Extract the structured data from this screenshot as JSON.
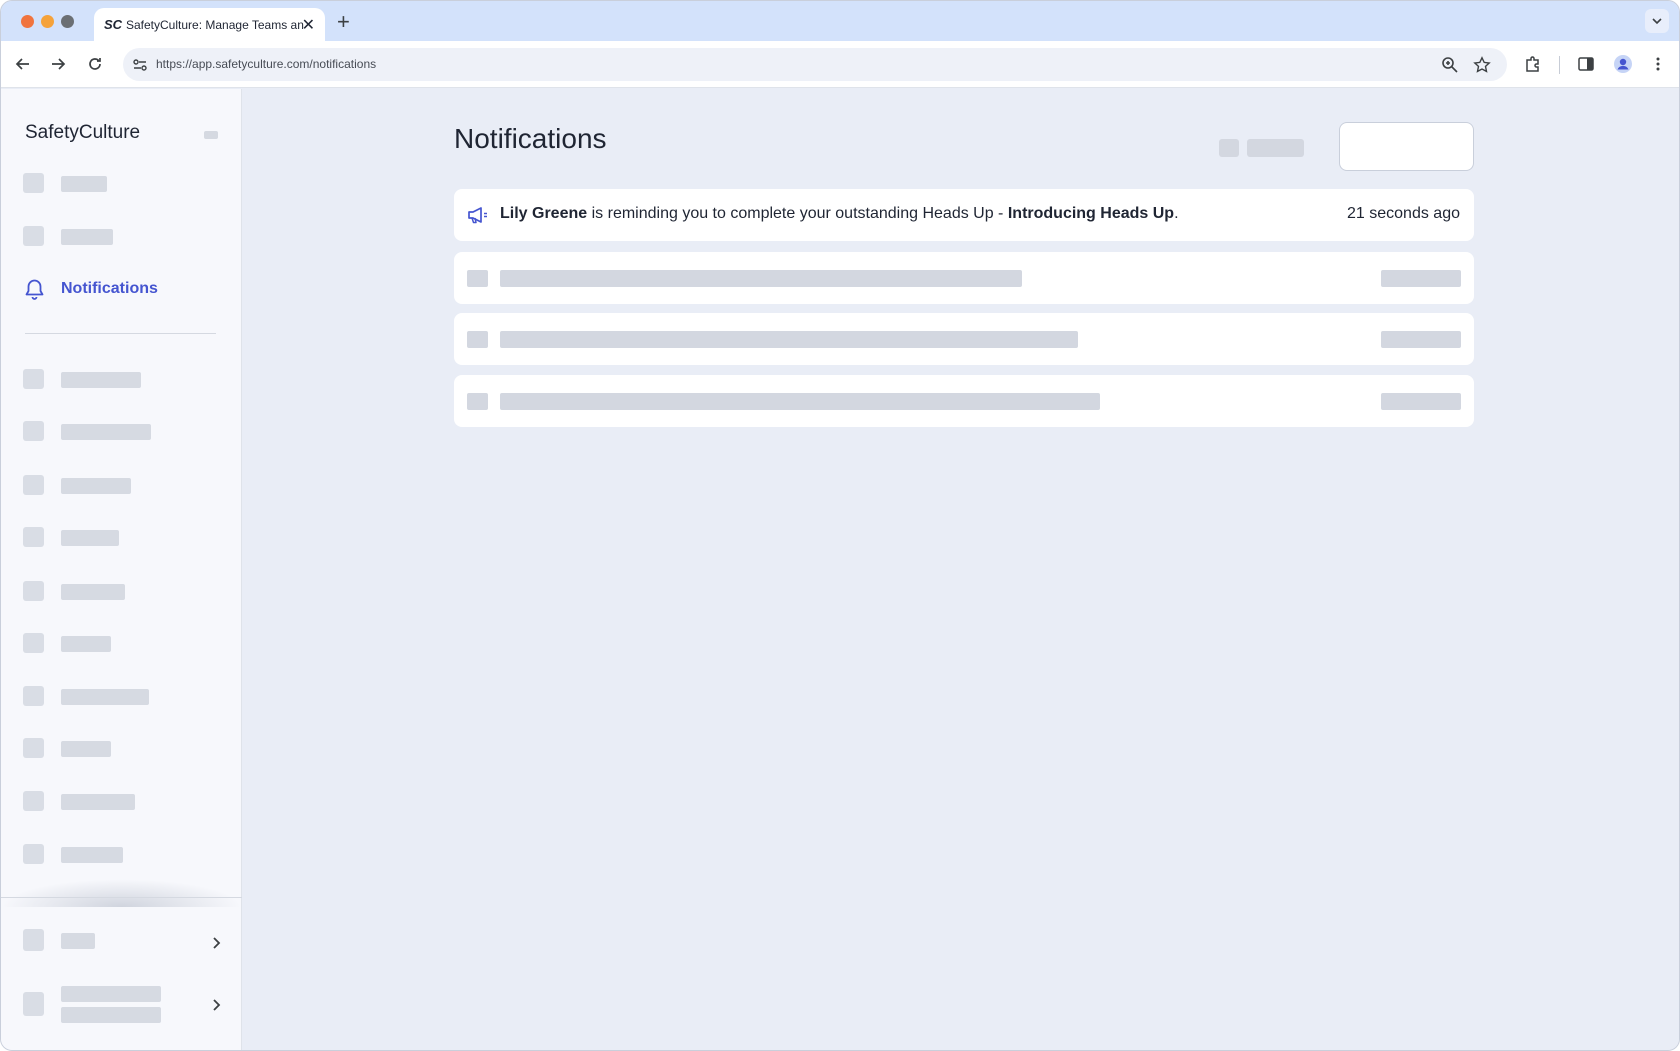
{
  "browser": {
    "tab_title": "SafetyCulture: Manage Teams and...",
    "tab_favicon_text": "SC",
    "url": "https://app.safetyculture.com/notifications"
  },
  "sidebar": {
    "brand": "SafetyCulture",
    "active_item": {
      "label": "Notifications",
      "icon": "bell-icon"
    }
  },
  "main": {
    "title": "Notifications",
    "notification": {
      "actor": "Lily Greene",
      "message": "is reminding you to complete your outstanding Heads Up -",
      "subject": "Introducing Heads Up",
      "suffix": ".",
      "time": "21 seconds ago",
      "icon": "megaphone-icon"
    }
  },
  "colors": {
    "accent": "#4555d0",
    "skeleton": "#d3d7e0",
    "background": "#e9edf6"
  }
}
